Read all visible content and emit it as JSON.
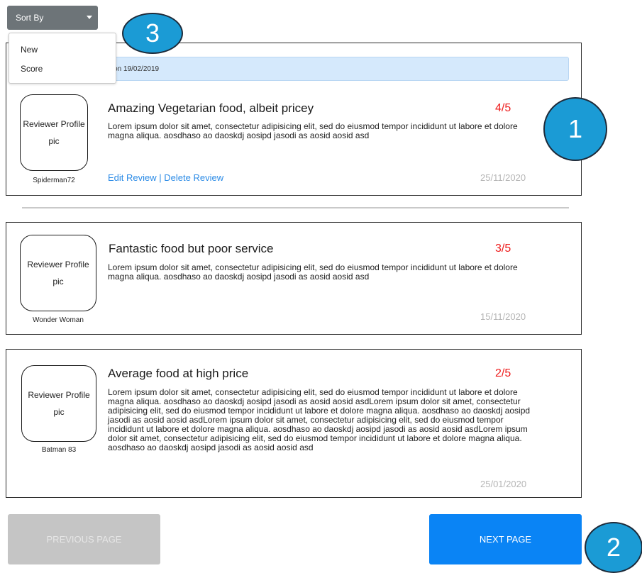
{
  "sort": {
    "label": "Sort By",
    "options": [
      "New",
      "Score"
    ]
  },
  "notice_text": "nt on 19/02/2019",
  "reviews": [
    {
      "title": "Amazing Vegetarian food, albeit pricey",
      "score": "4/5",
      "body": "Lorem ipsum dolor sit amet, consectetur adipisicing elit, sed do eiusmod tempor incididunt ut labore et dolore magna aliqua. aosdhaso ao daoskdj aosipd jasodi as aosid aosid asd",
      "avatar_line1": "Reviewer Profile",
      "avatar_line2": "pic",
      "reviewer": "Spiderman72",
      "date": "25/11/2020",
      "edit_label": "Edit  Review",
      "separator": "|",
      "delete_label": "Delete Review"
    },
    {
      "title": "Fantastic food but poor service",
      "score": "3/5",
      "body": "Lorem ipsum dolor sit amet, consectetur adipisicing elit, sed do eiusmod tempor incididunt ut labore et dolore magna aliqua. aosdhaso ao daoskdj aosipd jasodi as aosid aosid asd",
      "avatar_line1": "Reviewer Profile",
      "avatar_line2": "pic",
      "reviewer": "Wonder Woman",
      "date": "15/11/2020"
    },
    {
      "title": "Average food at high price",
      "score": "2/5",
      "body": "Lorem ipsum dolor sit amet, consectetur adipisicing elit, sed do eiusmod tempor incididunt ut labore et dolore magna aliqua. aosdhaso ao daoskdj aosipd jasodi as aosid aosid asdLorem ipsum dolor sit amet, consectetur adipisicing elit, sed do eiusmod tempor incididunt ut labore et dolore magna aliqua. aosdhaso ao daoskdj aosipd jasodi as aosid aosid asdLorem ipsum dolor sit amet, consectetur adipisicing elit, sed do eiusmod tempor incididunt ut labore et dolore magna aliqua. aosdhaso ao daoskdj aosipd jasodi as aosid aosid asdLorem ipsum dolor sit amet, consectetur adipisicing elit, sed do eiusmod tempor incididunt ut labore et dolore magna aliqua. aosdhaso ao daoskdj aosipd jasodi as aosid aosid asd",
      "avatar_line1": "Reviewer Profile",
      "avatar_line2": "pic",
      "reviewer": "Batman 83",
      "date": "25/01/2020"
    }
  ],
  "pagination": {
    "prev_label": "PREVIOUS PAGE",
    "next_label": "NEXT PAGE"
  },
  "markers": [
    "1",
    "2",
    "3"
  ],
  "colors": {
    "score": "#ee1c1c",
    "link": "#2b8be6",
    "next_button": "#0a84f5",
    "prev_button": "#c5c5c5",
    "sort_button": "#6d7478",
    "notice_bg": "#d5e9fc",
    "marker": "#1b9bd5"
  }
}
